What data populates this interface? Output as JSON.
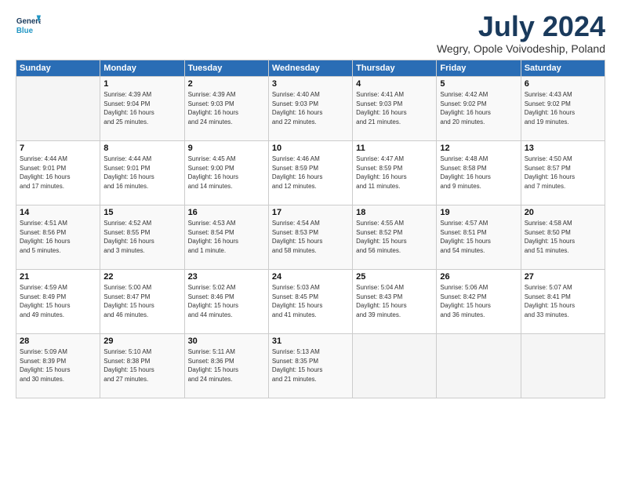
{
  "header": {
    "logo_line1": "General",
    "logo_line2": "Blue",
    "month": "July 2024",
    "location": "Wegry, Opole Voivodeship, Poland"
  },
  "weekdays": [
    "Sunday",
    "Monday",
    "Tuesday",
    "Wednesday",
    "Thursday",
    "Friday",
    "Saturday"
  ],
  "weeks": [
    [
      {
        "day": "",
        "info": ""
      },
      {
        "day": "1",
        "info": "Sunrise: 4:39 AM\nSunset: 9:04 PM\nDaylight: 16 hours\nand 25 minutes."
      },
      {
        "day": "2",
        "info": "Sunrise: 4:39 AM\nSunset: 9:03 PM\nDaylight: 16 hours\nand 24 minutes."
      },
      {
        "day": "3",
        "info": "Sunrise: 4:40 AM\nSunset: 9:03 PM\nDaylight: 16 hours\nand 22 minutes."
      },
      {
        "day": "4",
        "info": "Sunrise: 4:41 AM\nSunset: 9:03 PM\nDaylight: 16 hours\nand 21 minutes."
      },
      {
        "day": "5",
        "info": "Sunrise: 4:42 AM\nSunset: 9:02 PM\nDaylight: 16 hours\nand 20 minutes."
      },
      {
        "day": "6",
        "info": "Sunrise: 4:43 AM\nSunset: 9:02 PM\nDaylight: 16 hours\nand 19 minutes."
      }
    ],
    [
      {
        "day": "7",
        "info": "Sunrise: 4:44 AM\nSunset: 9:01 PM\nDaylight: 16 hours\nand 17 minutes."
      },
      {
        "day": "8",
        "info": "Sunrise: 4:44 AM\nSunset: 9:01 PM\nDaylight: 16 hours\nand 16 minutes."
      },
      {
        "day": "9",
        "info": "Sunrise: 4:45 AM\nSunset: 9:00 PM\nDaylight: 16 hours\nand 14 minutes."
      },
      {
        "day": "10",
        "info": "Sunrise: 4:46 AM\nSunset: 8:59 PM\nDaylight: 16 hours\nand 12 minutes."
      },
      {
        "day": "11",
        "info": "Sunrise: 4:47 AM\nSunset: 8:59 PM\nDaylight: 16 hours\nand 11 minutes."
      },
      {
        "day": "12",
        "info": "Sunrise: 4:48 AM\nSunset: 8:58 PM\nDaylight: 16 hours\nand 9 minutes."
      },
      {
        "day": "13",
        "info": "Sunrise: 4:50 AM\nSunset: 8:57 PM\nDaylight: 16 hours\nand 7 minutes."
      }
    ],
    [
      {
        "day": "14",
        "info": "Sunrise: 4:51 AM\nSunset: 8:56 PM\nDaylight: 16 hours\nand 5 minutes."
      },
      {
        "day": "15",
        "info": "Sunrise: 4:52 AM\nSunset: 8:55 PM\nDaylight: 16 hours\nand 3 minutes."
      },
      {
        "day": "16",
        "info": "Sunrise: 4:53 AM\nSunset: 8:54 PM\nDaylight: 16 hours\nand 1 minute."
      },
      {
        "day": "17",
        "info": "Sunrise: 4:54 AM\nSunset: 8:53 PM\nDaylight: 15 hours\nand 58 minutes."
      },
      {
        "day": "18",
        "info": "Sunrise: 4:55 AM\nSunset: 8:52 PM\nDaylight: 15 hours\nand 56 minutes."
      },
      {
        "day": "19",
        "info": "Sunrise: 4:57 AM\nSunset: 8:51 PM\nDaylight: 15 hours\nand 54 minutes."
      },
      {
        "day": "20",
        "info": "Sunrise: 4:58 AM\nSunset: 8:50 PM\nDaylight: 15 hours\nand 51 minutes."
      }
    ],
    [
      {
        "day": "21",
        "info": "Sunrise: 4:59 AM\nSunset: 8:49 PM\nDaylight: 15 hours\nand 49 minutes."
      },
      {
        "day": "22",
        "info": "Sunrise: 5:00 AM\nSunset: 8:47 PM\nDaylight: 15 hours\nand 46 minutes."
      },
      {
        "day": "23",
        "info": "Sunrise: 5:02 AM\nSunset: 8:46 PM\nDaylight: 15 hours\nand 44 minutes."
      },
      {
        "day": "24",
        "info": "Sunrise: 5:03 AM\nSunset: 8:45 PM\nDaylight: 15 hours\nand 41 minutes."
      },
      {
        "day": "25",
        "info": "Sunrise: 5:04 AM\nSunset: 8:43 PM\nDaylight: 15 hours\nand 39 minutes."
      },
      {
        "day": "26",
        "info": "Sunrise: 5:06 AM\nSunset: 8:42 PM\nDaylight: 15 hours\nand 36 minutes."
      },
      {
        "day": "27",
        "info": "Sunrise: 5:07 AM\nSunset: 8:41 PM\nDaylight: 15 hours\nand 33 minutes."
      }
    ],
    [
      {
        "day": "28",
        "info": "Sunrise: 5:09 AM\nSunset: 8:39 PM\nDaylight: 15 hours\nand 30 minutes."
      },
      {
        "day": "29",
        "info": "Sunrise: 5:10 AM\nSunset: 8:38 PM\nDaylight: 15 hours\nand 27 minutes."
      },
      {
        "day": "30",
        "info": "Sunrise: 5:11 AM\nSunset: 8:36 PM\nDaylight: 15 hours\nand 24 minutes."
      },
      {
        "day": "31",
        "info": "Sunrise: 5:13 AM\nSunset: 8:35 PM\nDaylight: 15 hours\nand 21 minutes."
      },
      {
        "day": "",
        "info": ""
      },
      {
        "day": "",
        "info": ""
      },
      {
        "day": "",
        "info": ""
      }
    ]
  ]
}
